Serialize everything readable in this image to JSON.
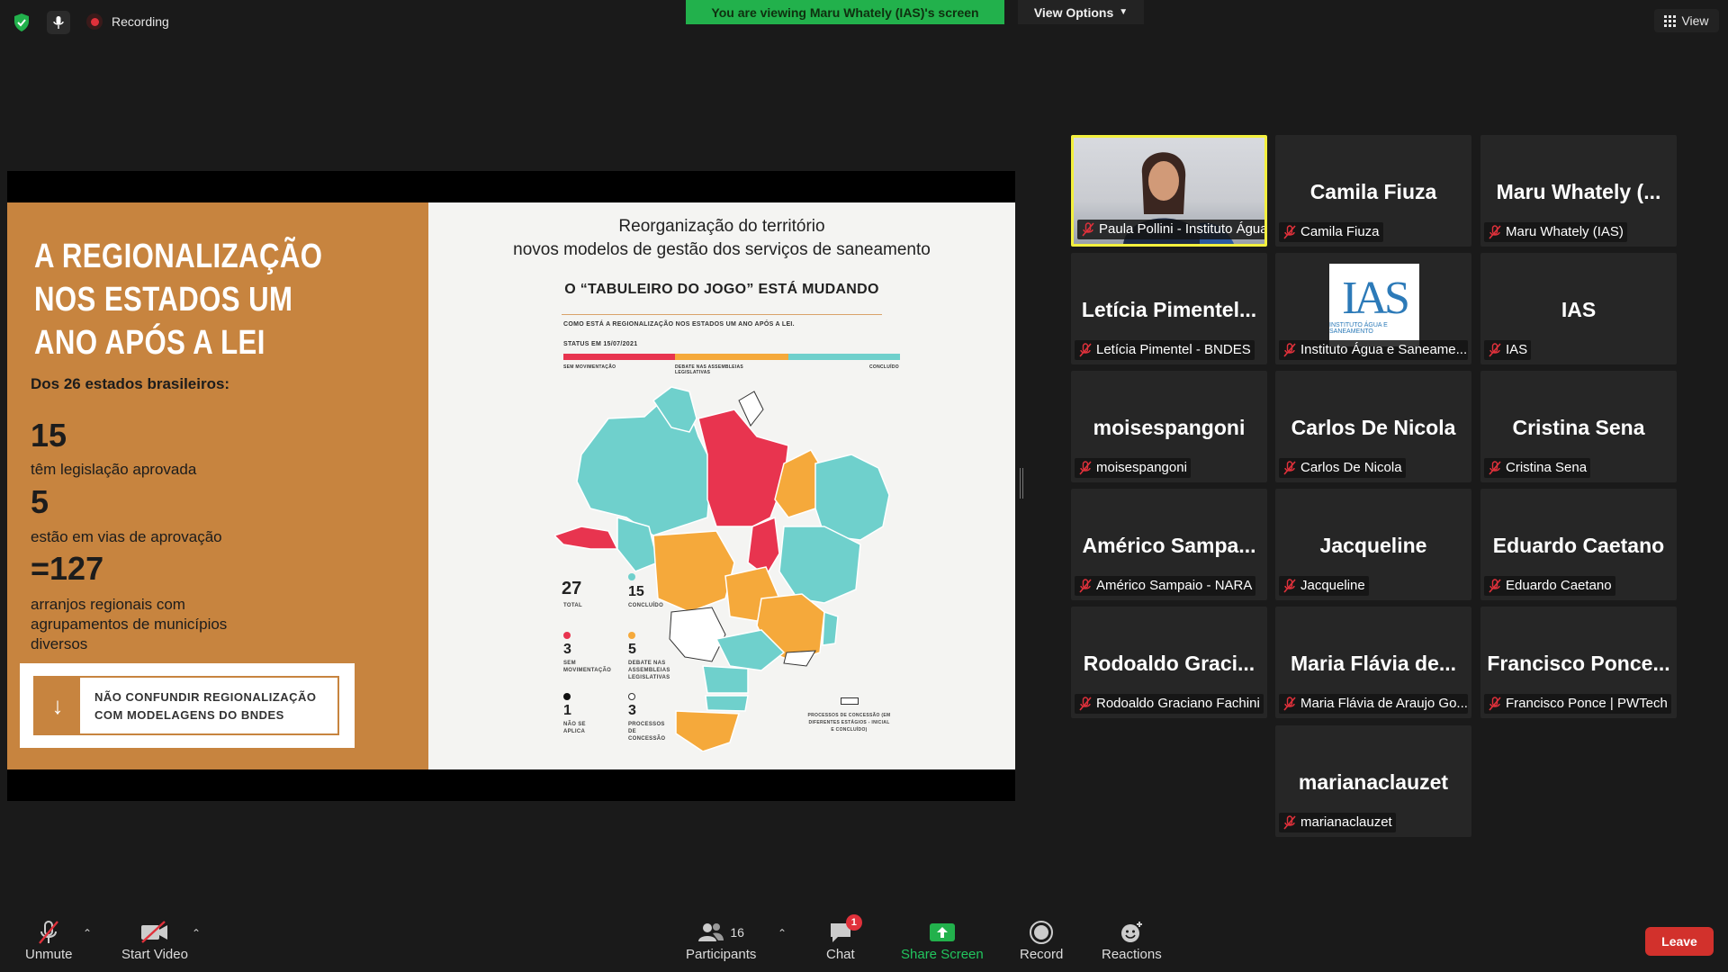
{
  "topbar": {
    "recording_label": "Recording",
    "viewing_banner": "You are viewing Maru Whately (IAS)'s screen",
    "view_options_label": "View Options",
    "view_label": "View"
  },
  "slide": {
    "left": {
      "title_line1": "A REGIONALIZAÇÃO",
      "title_line2": "NOS ESTADOS UM",
      "title_line3": "ANO APÓS A LEI",
      "subtitle": "Dos 26 estados brasileiros:",
      "stat1_num": "15",
      "stat1_text": "têm legislação aprovada",
      "stat2_num": "5",
      "stat2_text": "estão em vias de aprovação",
      "stat3_num": "=127",
      "stat3_text_line1": "arranjos regionais com",
      "stat3_text_line2": "agrupamentos de municípios",
      "stat3_text_line3": "diversos",
      "box_line1": "NÃO CONFUNDIR REGIONALIZAÇÃO",
      "box_line2": "COM MODELAGENS DO BNDES"
    },
    "right": {
      "title_line1": "Reorganização do território",
      "title_line2": "novos modelos de gestão dos serviços de saneamento",
      "headline": "O “TABULEIRO DO JOGO” ESTÁ MUDANDO",
      "question": "COMO ESTÁ A REGIONALIZAÇÃO NOS ESTADOS UM ANO APÓS A LEI.",
      "status_label": "STATUS EM 15/07/2021",
      "bar_label_1": "SEM MOVIMENTAÇÃO",
      "bar_label_2": "DEBATE NAS ASSEMBLEIAS LEGISLATIVAS",
      "bar_label_3": "CONCLUÍDO",
      "legend": [
        {
          "num": "27",
          "cap": "TOTAL"
        },
        {
          "num": "15",
          "cap": "CONCLUÍDO"
        },
        {
          "num": "3",
          "cap": "SEM MOVIMENTAÇÃO"
        },
        {
          "num": "5",
          "cap": "DEBATE NAS ASSEMBLEIAS LEGISLATIVAS"
        },
        {
          "num": "1",
          "cap": "NÃO SE APLICA"
        },
        {
          "num": "3",
          "cap": "PROCESSOS DE CONCESSÃO"
        }
      ],
      "concession_note": "PROCESSOS DE CONCESSÃO (EM DIFERENTES ESTÁGIOS - INICIAL E CONCLUÍDO)",
      "colors": {
        "red": "#e8344f",
        "orange": "#f5a93b",
        "teal": "#6fd0cc",
        "white": "#ffffff"
      }
    }
  },
  "participants": [
    {
      "big": "",
      "label": "Paula Pollini - Instituto Água ...",
      "type": "video"
    },
    {
      "big": "Camila Fiuza",
      "label": "Camila Fiuza"
    },
    {
      "big": "Maru  Whately  (...",
      "label": "Maru Whately (IAS)"
    },
    {
      "big": "Letícia  Pimentel...",
      "label": "Letícia Pimentel - BNDES"
    },
    {
      "big": "",
      "label": "Instituto Água e Saneame...",
      "type": "logo"
    },
    {
      "big": "IAS",
      "label": "IAS"
    },
    {
      "big": "moisespangoni",
      "label": "moisespangoni"
    },
    {
      "big": "Carlos De Nicola",
      "label": "Carlos De Nicola"
    },
    {
      "big": "Cristina Sena",
      "label": "Cristina Sena"
    },
    {
      "big": "Américo  Sampa...",
      "label": "Américo Sampaio - NARA"
    },
    {
      "big": "Jacqueline",
      "label": "Jacqueline"
    },
    {
      "big": "Eduardo Caetano",
      "label": "Eduardo Caetano"
    },
    {
      "big": "Rodoaldo  Graci...",
      "label": "Rodoaldo Graciano Fachini"
    },
    {
      "big": "Maria  Flávia  de...",
      "label": "Maria Flávia de Araujo Go..."
    },
    {
      "big": "Francisco  Ponce...",
      "label": "Francisco Ponce | PWTech"
    },
    {
      "big": "marianaclauzet",
      "label": "marianaclauzet"
    }
  ],
  "ias_logo": {
    "text": "IAS",
    "caption": "INSTITUTO ÁGUA E SANEAMENTO"
  },
  "toolbar": {
    "unmute": "Unmute",
    "start_video": "Start Video",
    "participants": "Participants",
    "participants_count": "16",
    "chat": "Chat",
    "chat_badge": "1",
    "share_screen": "Share Screen",
    "record": "Record",
    "reactions": "Reactions",
    "leave": "Leave"
  }
}
